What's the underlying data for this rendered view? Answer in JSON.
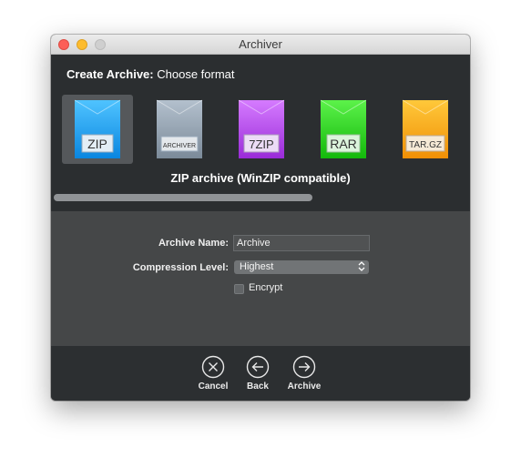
{
  "window": {
    "title": "Archiver"
  },
  "header": {
    "prefix": "Create Archive:",
    "text": "Choose format"
  },
  "formats": [
    {
      "label": "ZIP",
      "color": "#1aa6f5",
      "selected": true
    },
    {
      "label": "ARCHIVER",
      "color": "#8d9bab",
      "selected": false
    },
    {
      "label": "7ZIP",
      "color": "#b03fe6",
      "selected": false
    },
    {
      "label": "RAR",
      "color": "#29d61f",
      "selected": false
    },
    {
      "label": "TAR.GZ",
      "color": "#f7a511",
      "selected": false
    }
  ],
  "selected_description": "ZIP archive (WinZIP compatible)",
  "form": {
    "archive_name_label": "Archive Name:",
    "archive_name_value": "Archive",
    "compression_label": "Compression Level:",
    "compression_value": "Highest",
    "encrypt_label": "Encrypt",
    "encrypt_checked": false
  },
  "buttons": {
    "cancel": "Cancel",
    "back": "Back",
    "archive": "Archive"
  }
}
